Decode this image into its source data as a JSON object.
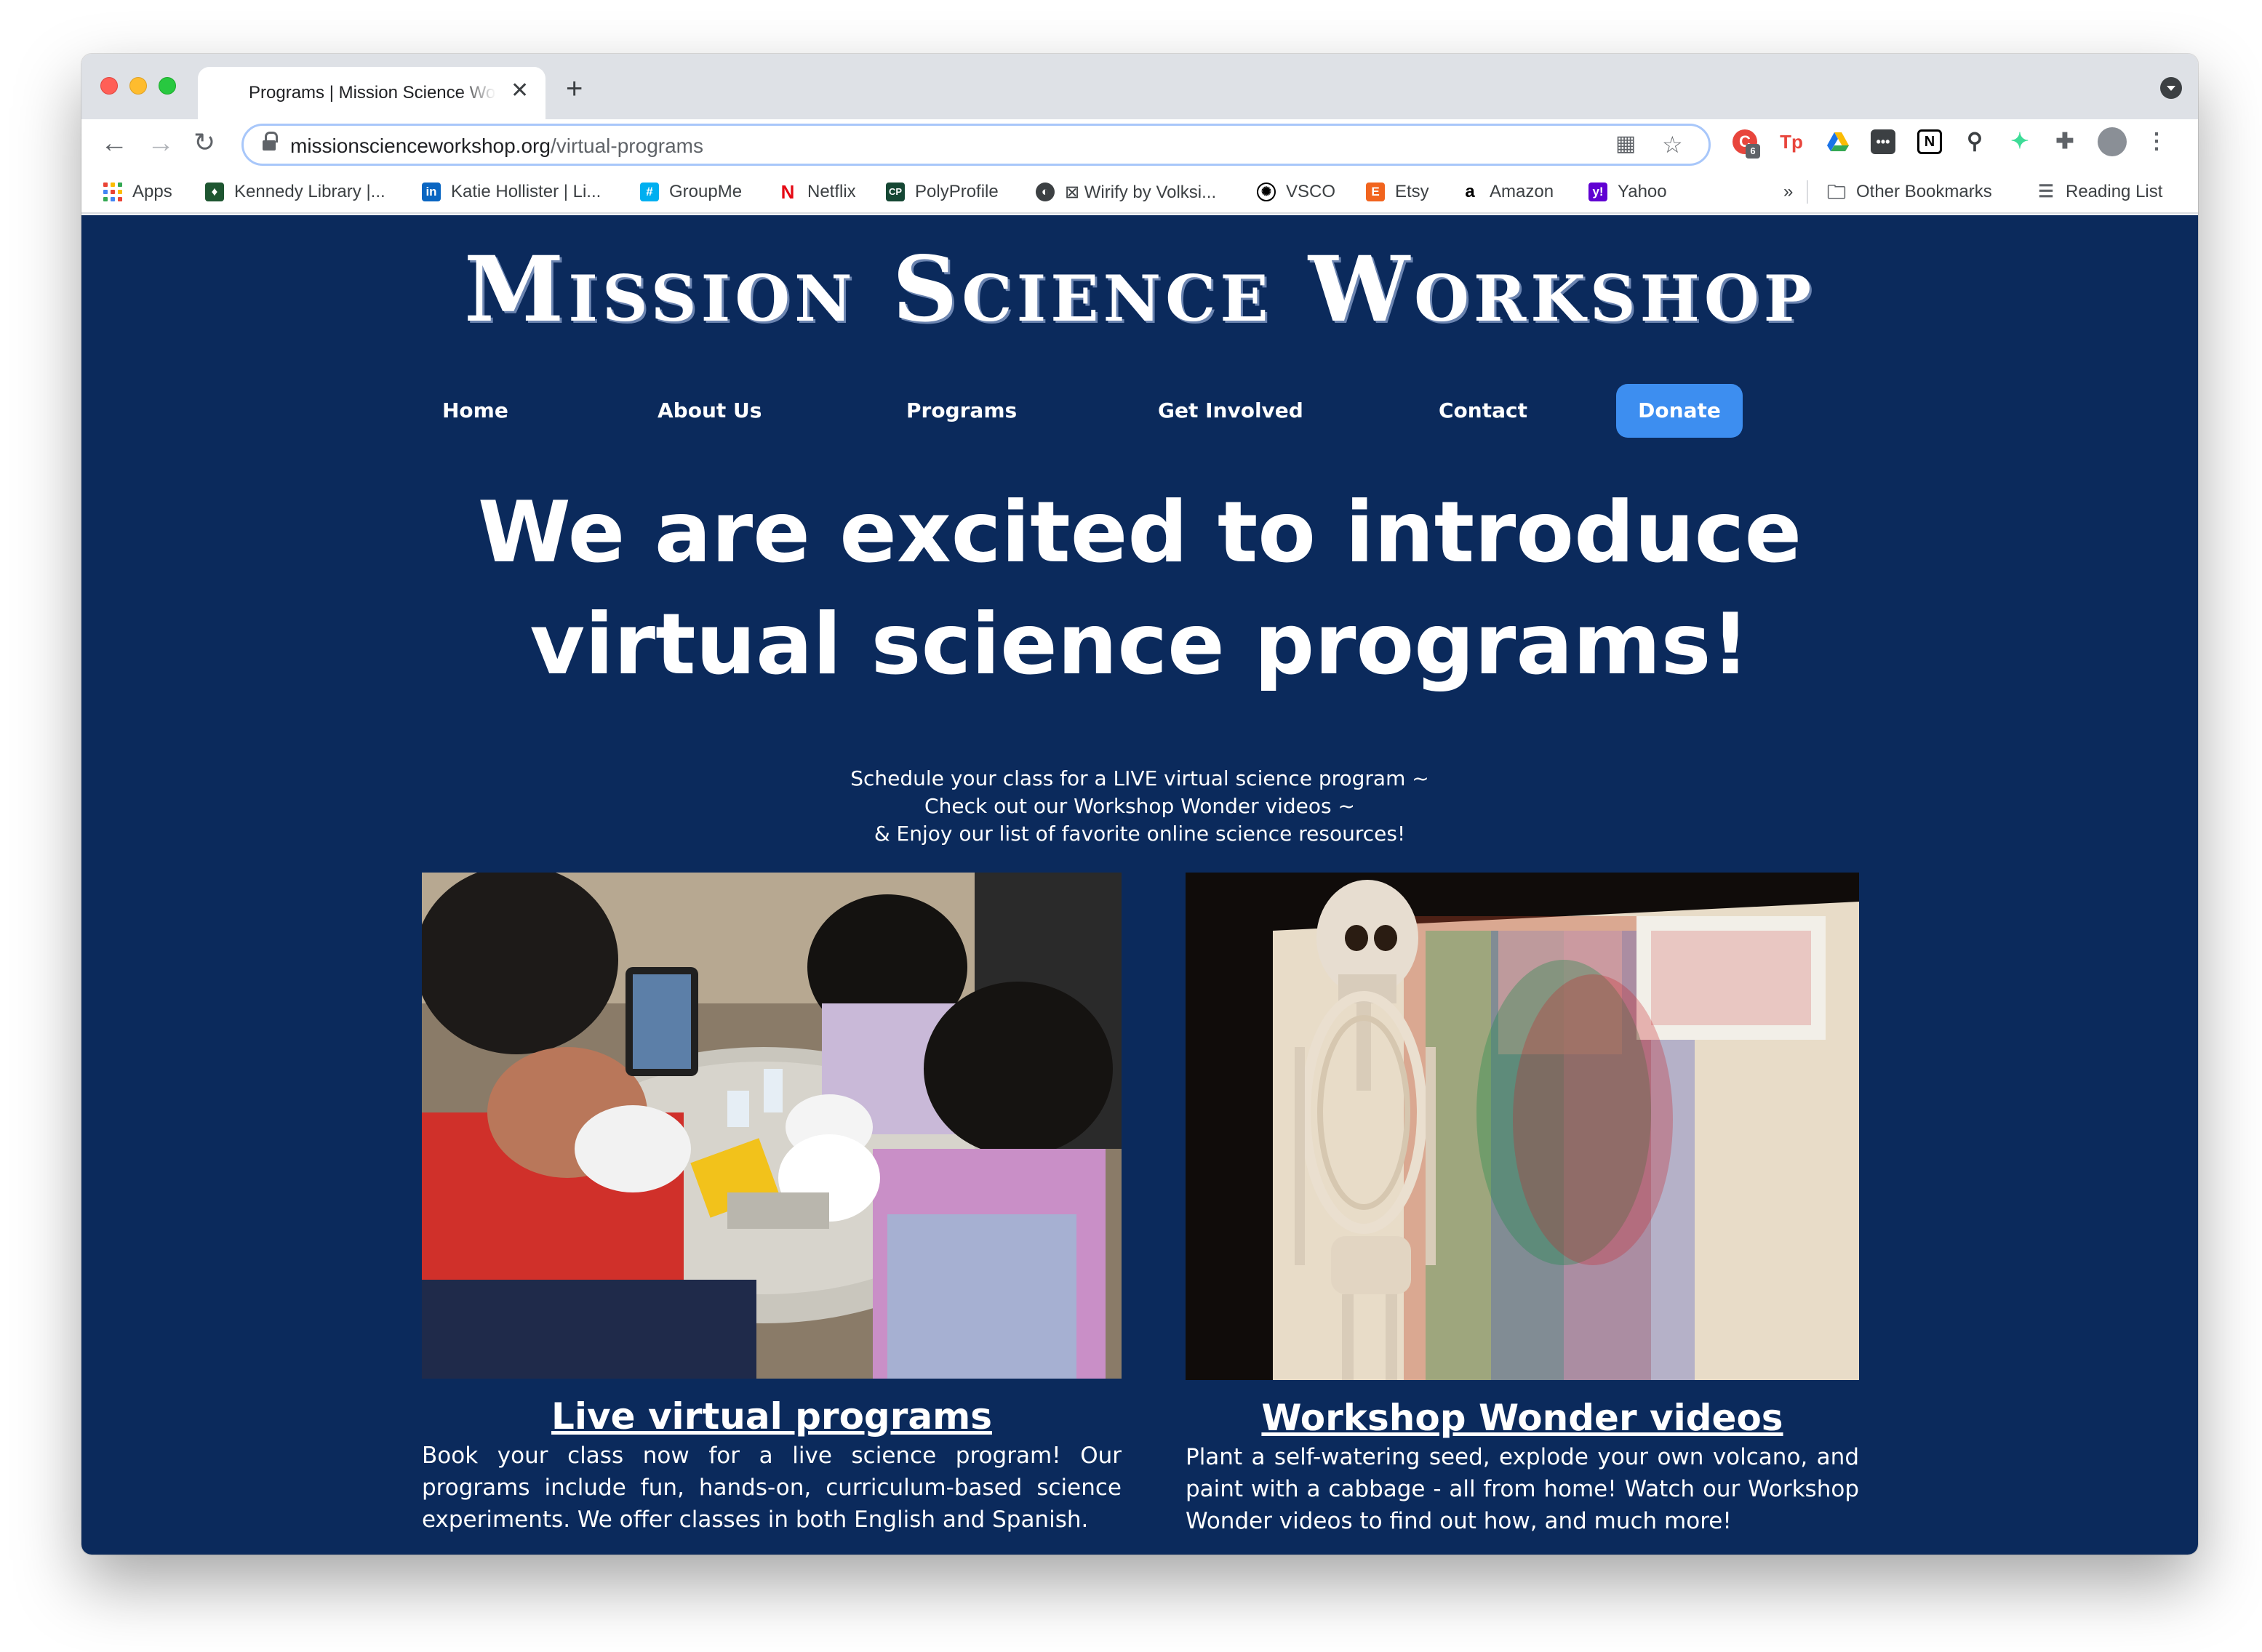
{
  "browser": {
    "tab_title": "Programs | Mission Science Workshop",
    "url_host": "missionscienceworkshop.org",
    "url_path": "/virtual-programs",
    "bookmarks": [
      {
        "label": "Apps",
        "icon": "apps-grid-icon"
      },
      {
        "label": "Kennedy Library |...",
        "icon": "shield-icon"
      },
      {
        "label": "Katie Hollister | Li...",
        "icon": "linkedin-icon"
      },
      {
        "label": "GroupMe",
        "icon": "groupme-icon"
      },
      {
        "label": "Netflix",
        "icon": "netflix-icon"
      },
      {
        "label": "PolyProfile",
        "icon": "polyprofile-icon"
      },
      {
        "label": "⊠ Wirify by Volksi...",
        "icon": "globe-icon"
      },
      {
        "label": "VSCO",
        "icon": "vsco-icon"
      },
      {
        "label": "Etsy",
        "icon": "etsy-icon"
      },
      {
        "label": "Amazon",
        "icon": "amazon-icon"
      },
      {
        "label": "Yahoo",
        "icon": "yahoo-icon"
      }
    ],
    "other_bookmarks": "Other Bookmarks",
    "reading_list": "Reading List",
    "overflow": "»",
    "extension_badge": "6"
  },
  "site": {
    "logo": "Mission Science Workshop",
    "nav": [
      "Home",
      "About Us",
      "Programs",
      "Get Involved",
      "Contact"
    ],
    "donate": "Donate",
    "hero_line1": "We are excited to introduce",
    "hero_line2": "virtual science programs!",
    "sub_lines": [
      "Schedule your class for a LIVE virtual science program ~",
      "Check out our Workshop Wonder videos ~",
      "& Enjoy our list of favorite online science resources!"
    ],
    "cards": [
      {
        "title": "Live virtual programs",
        "description": "Book your class now for a live science program! Our programs include fun, hands-on, curriculum-based science experiments. We offer classes in both English and Spanish.",
        "image": "kids-doing-experiment-photo"
      },
      {
        "title": "Workshop Wonder videos",
        "description": "Plant a self-watering seed, explode your own volcano, and paint with a cabbage - all from home! Watch our Workshop Wonder videos to find out how, and much more!",
        "image": "skeleton-colored-shadows-photo"
      }
    ]
  },
  "colors": {
    "page_background": "#0b2a5c",
    "donate_button": "#3d8ef0",
    "text": "#ffffff"
  }
}
